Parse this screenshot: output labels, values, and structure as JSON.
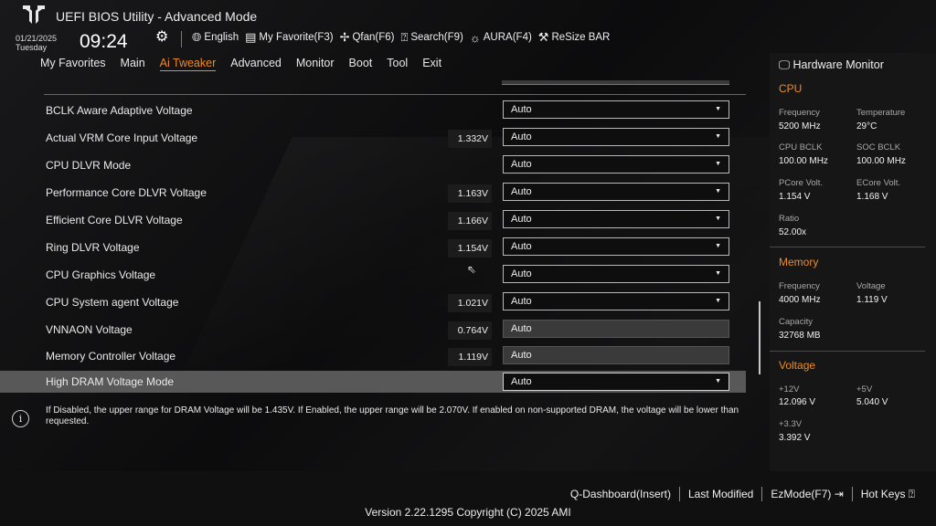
{
  "app": {
    "title": "UEFI BIOS Utility - Advanced Mode"
  },
  "datetime": {
    "date": "01/21/2025",
    "day": "Tuesday",
    "time": "09:24"
  },
  "toolbar": [
    {
      "icon": "globe-icon",
      "label": "English"
    },
    {
      "icon": "favorite-icon",
      "label": "My Favorite(F3)"
    },
    {
      "icon": "fan-icon",
      "label": "Qfan(F6)"
    },
    {
      "icon": "search-icon",
      "label": "Search(F9)"
    },
    {
      "icon": "aura-icon",
      "label": "AURA(F4)"
    },
    {
      "icon": "resize-bar-icon",
      "label": "ReSize BAR"
    }
  ],
  "nav": [
    "My Favorites",
    "Main",
    "Ai Tweaker",
    "Advanced",
    "Monitor",
    "Boot",
    "Tool",
    "Exit"
  ],
  "nav_active": "Ai Tweaker",
  "settings": [
    {
      "label": "BCLK Aware Adaptive Voltage",
      "value": "",
      "option": "Auto",
      "editable": true
    },
    {
      "label": "Actual VRM Core Input Voltage",
      "value": "1.332V",
      "option": "Auto",
      "editable": true
    },
    {
      "label": "CPU DLVR Mode",
      "value": "",
      "option": "Auto",
      "editable": true
    },
    {
      "label": "Performance Core DLVR Voltage",
      "value": "1.163V",
      "option": "Auto",
      "editable": true
    },
    {
      "label": "Efficient Core DLVR Voltage",
      "value": "1.166V",
      "option": "Auto",
      "editable": true
    },
    {
      "label": "Ring DLVR Voltage",
      "value": "1.154V",
      "option": "Auto",
      "editable": true
    },
    {
      "label": "CPU Graphics Voltage",
      "value": "",
      "option": "Auto",
      "editable": true
    },
    {
      "label": "CPU System agent Voltage",
      "value": "1.021V",
      "option": "Auto",
      "editable": true
    },
    {
      "label": "VNNAON Voltage",
      "value": "0.764V",
      "option": "Auto",
      "editable": false
    },
    {
      "label": "Memory Controller Voltage",
      "value": "1.119V",
      "option": "Auto",
      "editable": false
    },
    {
      "label": "High DRAM Voltage Mode",
      "value": "",
      "option": "Auto",
      "editable": true,
      "selected": true
    }
  ],
  "help": "If Disabled, the upper range for DRAM Voltage will be 1.435V. If Enabled, the upper range will be 2.070V. If enabled on non-supported DRAM, the voltage will be lower than requested.",
  "hw": {
    "title": "Hardware Monitor",
    "cpu": {
      "section": "CPU",
      "frequency_label": "Frequency",
      "frequency": "5200 MHz",
      "temperature_label": "Temperature",
      "temperature": "29°C",
      "bclk_label": "CPU BCLK",
      "bclk": "100.00 MHz",
      "soc_bclk_label": "SOC BCLK",
      "soc_bclk": "100.00 MHz",
      "pcore_label": "PCore Volt.",
      "pcore": "1.154 V",
      "ecore_label": "ECore Volt.",
      "ecore": "1.168 V",
      "ratio_label": "Ratio",
      "ratio": "52.00x"
    },
    "memory": {
      "section": "Memory",
      "frequency_label": "Frequency",
      "frequency": "4000 MHz",
      "voltage_label": "Voltage",
      "voltage": "1.119 V",
      "capacity_label": "Capacity",
      "capacity": "32768 MB"
    },
    "voltage": {
      "section": "Voltage",
      "v12_label": "+12V",
      "v12": "12.096 V",
      "v5_label": "+5V",
      "v5": "5.040 V",
      "v33_label": "+3.3V",
      "v33": "3.392 V"
    }
  },
  "footer": {
    "qdashboard": "Q-Dashboard(Insert)",
    "last_modified": "Last Modified",
    "ezmode": "EzMode(F7)",
    "hotkeys": "Hot Keys",
    "version": "Version 2.22.1295 Copyright (C) 2025 AMI"
  },
  "colors": {
    "accent": "#f08a24",
    "highlight_row": "#585858",
    "background": "#0f0f10"
  }
}
